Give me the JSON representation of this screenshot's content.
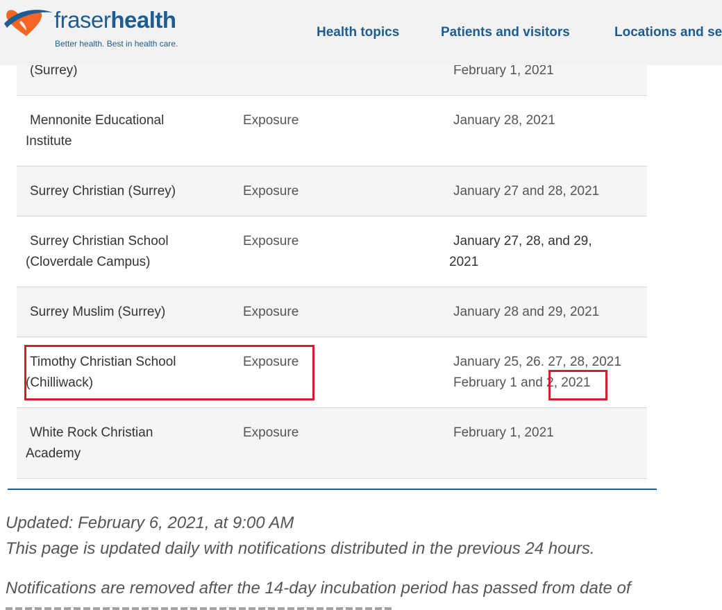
{
  "header": {
    "logo": {
      "word_part1": "fraser",
      "word_part2": "health",
      "tagline": "Better health. Best in health care.",
      "colors": {
        "blue": "#1b5d93",
        "orange": "#f26522"
      }
    },
    "nav": [
      {
        "label": "Health topics"
      },
      {
        "label": "Patients and visitors"
      },
      {
        "label": "Locations and se"
      }
    ]
  },
  "table": {
    "rows": [
      {
        "name_l1": "",
        "name_l2": "(Surrey)",
        "type": "",
        "date_l1": "February 1, 2021",
        "date_l2": ""
      },
      {
        "name_l1": "Mennonite Educational",
        "name_l2": "Institute",
        "type": "Exposure",
        "date_l1": "January 28, 2021",
        "date_l2": ""
      },
      {
        "name_l1": "Surrey Christian (Surrey)",
        "name_l2": "",
        "type": "Exposure",
        "date_l1": "January 27 and 28, 2021",
        "date_l2": ""
      },
      {
        "name_l1": "Surrey Christian School",
        "name_l2": "(Cloverdale Campus)",
        "type": "Exposure",
        "date_l1": "January 27, 28, and 29,",
        "date_l2": "2021"
      },
      {
        "name_l1": "Surrey Muslim (Surrey)",
        "name_l2": "",
        "type": "Exposure",
        "date_l1": "January 28 and 29,  2021",
        "date_l2": ""
      },
      {
        "name_l1": "Timothy Christian School",
        "name_l2": "(Chilliwack)",
        "type": "Exposure",
        "date_l1": "January 25, 26. 27, 28, 2021",
        "date_l2": "February 1 and 2, 2021"
      },
      {
        "name_l1": "White Rock Christian",
        "name_l2": "Academy",
        "type": "Exposure",
        "date_l1": "February 1, 2021",
        "date_l2": ""
      }
    ],
    "highlight_color": "#d0202e"
  },
  "footer": {
    "updated": "Updated: February 6, 2021, at 9:00 AM",
    "daily_note": "This page is updated daily with notifications distributed in the previous 24 hours.",
    "removal_note": "Notifications are removed after the 14-day incubation period has passed from date of"
  }
}
